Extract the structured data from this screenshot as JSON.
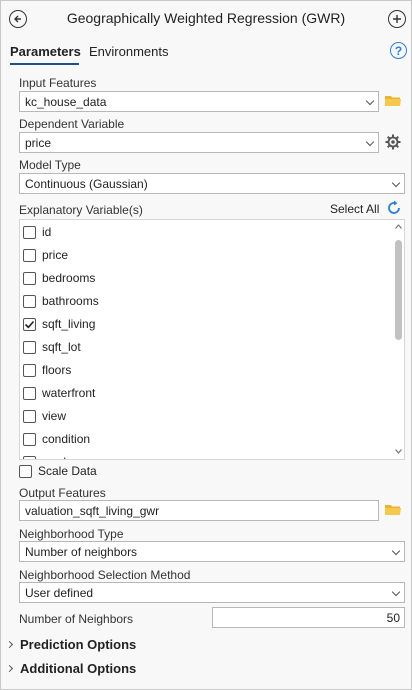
{
  "header": {
    "title": "Geographically Weighted Regression (GWR)"
  },
  "tabs": [
    {
      "label": "Parameters",
      "active": true
    },
    {
      "label": "Environments",
      "active": false
    }
  ],
  "form": {
    "input_features": {
      "label": "Input Features",
      "value": "kc_house_data"
    },
    "dependent_variable": {
      "label": "Dependent Variable",
      "value": "price"
    },
    "model_type": {
      "label": "Model Type",
      "value": "Continuous (Gaussian)"
    },
    "explanatory": {
      "label": "Explanatory Variable(s)",
      "select_all": "Select All",
      "items": [
        {
          "label": "id",
          "checked": false
        },
        {
          "label": "price",
          "checked": false
        },
        {
          "label": "bedrooms",
          "checked": false
        },
        {
          "label": "bathrooms",
          "checked": false
        },
        {
          "label": "sqft_living",
          "checked": true
        },
        {
          "label": "sqft_lot",
          "checked": false
        },
        {
          "label": "floors",
          "checked": false
        },
        {
          "label": "waterfront",
          "checked": false
        },
        {
          "label": "view",
          "checked": false
        },
        {
          "label": "condition",
          "checked": false
        },
        {
          "label": "grade",
          "checked": false
        }
      ]
    },
    "scale_data": {
      "label": "Scale Data",
      "checked": false
    },
    "output_features": {
      "label": "Output Features",
      "value": "valuation_sqft_living_gwr"
    },
    "neighborhood_type": {
      "label": "Neighborhood Type",
      "value": "Number of neighbors"
    },
    "neighborhood_selection": {
      "label": "Neighborhood Selection Method",
      "value": "User defined"
    },
    "number_of_neighbors": {
      "label": "Number of Neighbors",
      "value": "50"
    }
  },
  "sections": {
    "prediction": "Prediction Options",
    "additional": "Additional Options"
  },
  "colors": {
    "accent": "#2d7fd6",
    "folder": "#e8b431",
    "tab_underline": "#1f4e8c"
  }
}
